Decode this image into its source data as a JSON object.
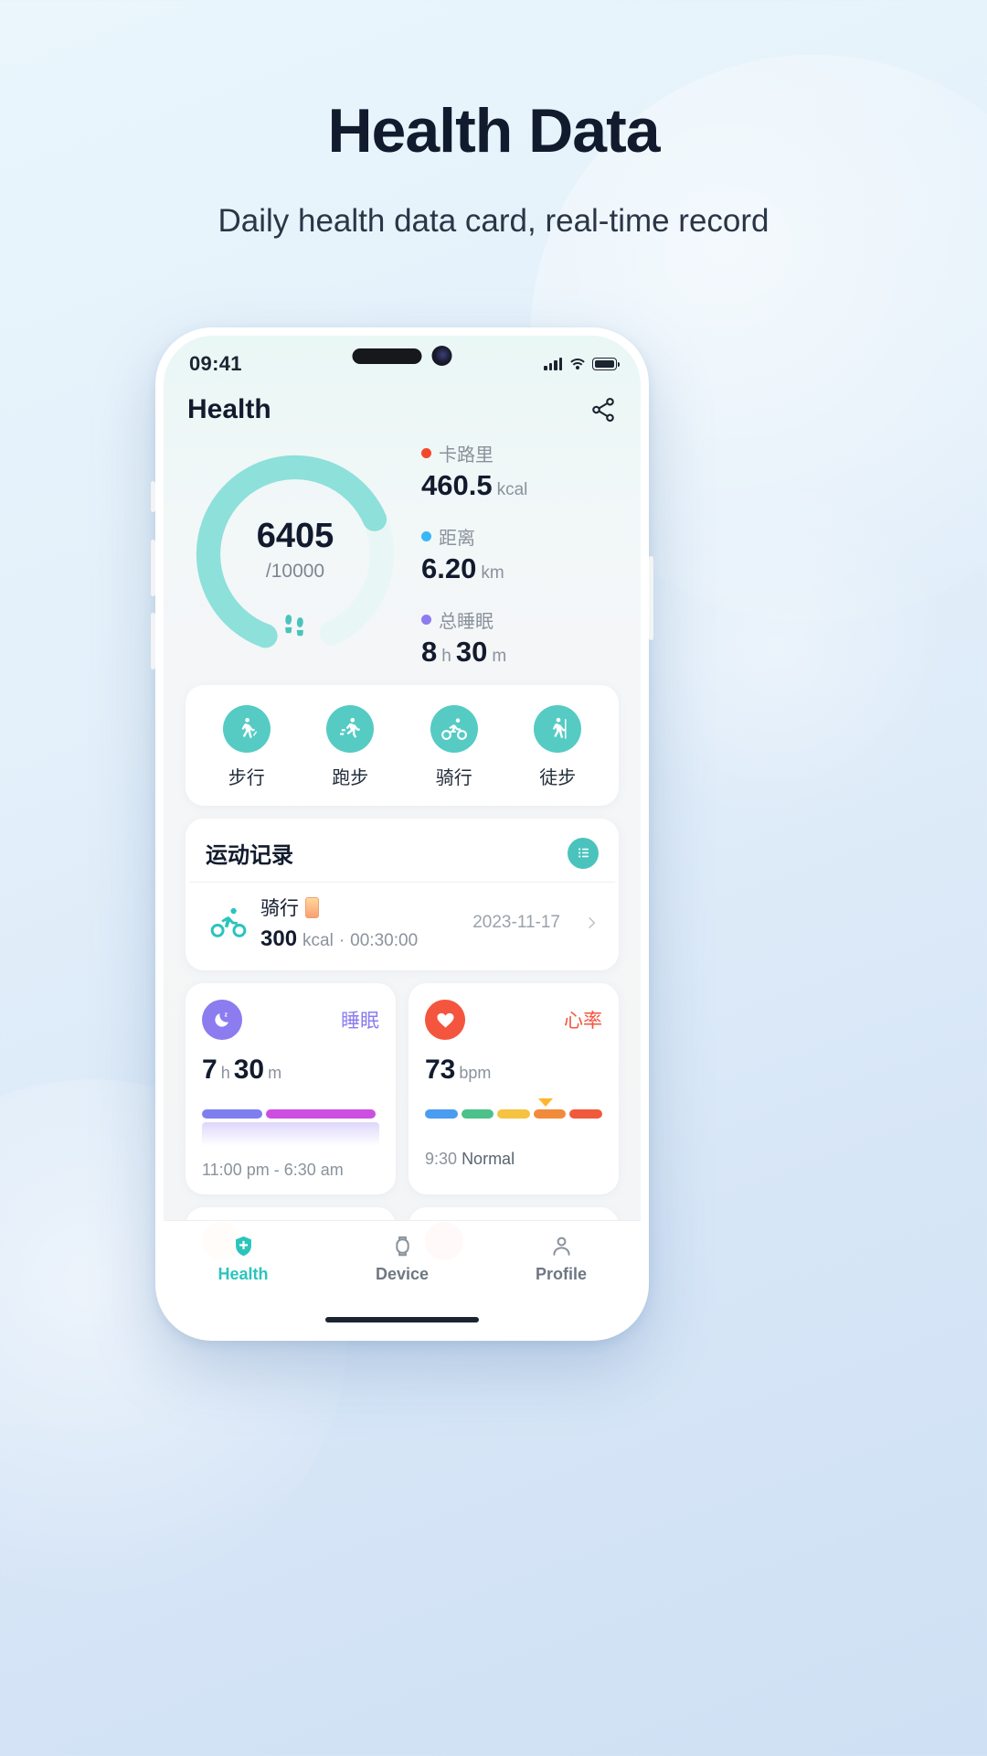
{
  "page": {
    "title": "Health Data",
    "subtitle": "Daily health data card, real-time record"
  },
  "colors": {
    "accent": "#4ac3bd",
    "calories": "#f4482a",
    "distance": "#39b6f7",
    "sleep": "#8b7cf0",
    "heart": "#f4553f",
    "page_bg": "#dbe9f7"
  },
  "status_bar": {
    "time": "09:41",
    "signal_icon": "cellular-signal-icon",
    "wifi_icon": "wifi-icon",
    "battery_icon": "battery-icon"
  },
  "app_header": {
    "title": "Health",
    "share_icon": "share-icon"
  },
  "summary": {
    "ring": {
      "steps": "6405",
      "goal": "/10000",
      "footprints_icon": "footprints-icon",
      "progress_percent": 64
    },
    "stats": [
      {
        "label": "卡路里",
        "value": "460.5",
        "unit": "kcal",
        "color": "#f4482a",
        "icon": "calories-dot-icon"
      },
      {
        "label": "距离",
        "value": "6.20",
        "unit": "km",
        "color": "#39b6f7",
        "icon": "distance-dot-icon"
      },
      {
        "label": "总睡眠",
        "value_hours": "8",
        "unit_hours": "h",
        "value_minutes": "30",
        "unit_minutes": "m",
        "color": "#8b7cf0",
        "icon": "sleep-dot-icon"
      }
    ]
  },
  "activities": [
    {
      "label": "步行",
      "icon": "walking-icon"
    },
    {
      "label": "跑步",
      "icon": "running-icon"
    },
    {
      "label": "骑行",
      "icon": "cycling-icon"
    },
    {
      "label": "徒步",
      "icon": "hiking-icon"
    }
  ],
  "records": {
    "title": "运动记录",
    "list_icon": "list-view-icon",
    "rows": [
      {
        "icon": "cycling-icon",
        "name": "骑行",
        "badge_icon": "phone-badge-icon",
        "calories": "300",
        "calories_unit": "kcal",
        "separator": "·",
        "duration": "00:30:00",
        "date": "2023-11-17",
        "chevron_icon": "chevron-right-icon"
      }
    ]
  },
  "sleep_card": {
    "icon": "moon-sleep-icon",
    "label": "睡眠",
    "hours": "7",
    "hours_unit": "h",
    "minutes": "30",
    "minutes_unit": "m",
    "range": "11:00 pm - 6:30 am",
    "segments": [
      {
        "color": "#7e7ef0",
        "width": 34
      },
      {
        "color": "#cc4fe0",
        "width": 62
      }
    ]
  },
  "heart_card": {
    "icon": "heart-icon",
    "label": "心率",
    "value": "73",
    "unit": "bpm",
    "time": "9:30",
    "status": "Normal",
    "marker_icon": "range-marker-icon",
    "segments": [
      {
        "color": "#4a9cf0"
      },
      {
        "color": "#4cc18a"
      },
      {
        "color": "#f5c341"
      },
      {
        "color": "#f28a3c"
      },
      {
        "color": "#ef5a3c"
      }
    ]
  },
  "tabbar": [
    {
      "label": "Health",
      "icon": "health-shield-icon",
      "active": true
    },
    {
      "label": "Device",
      "icon": "watch-device-icon",
      "active": false
    },
    {
      "label": "Profile",
      "icon": "person-profile-icon",
      "active": false
    }
  ]
}
